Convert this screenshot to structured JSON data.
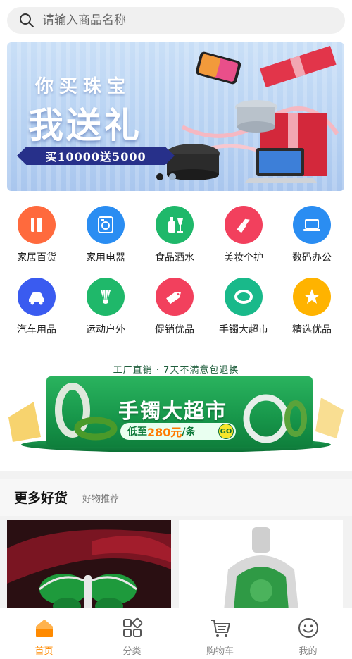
{
  "search": {
    "placeholder": "请输入商品名称"
  },
  "banner": {
    "line1": "你买珠宝",
    "line2": "我送礼",
    "promo": "买10000送5000",
    "slides": 2,
    "active_slide": 1
  },
  "categories": [
    {
      "label": "家居百货",
      "icon": "home-goods-icon",
      "color": "#ff6a3d"
    },
    {
      "label": "家用电器",
      "icon": "washing-machine-icon",
      "color": "#2a8df2"
    },
    {
      "label": "食品酒水",
      "icon": "wine-bottle-icon",
      "color": "#1fb86a"
    },
    {
      "label": "美妆个护",
      "icon": "lipstick-icon",
      "color": "#f2405d"
    },
    {
      "label": "数码办公",
      "icon": "laptop-icon",
      "color": "#2a8df2"
    },
    {
      "label": "汽车用品",
      "icon": "car-icon",
      "color": "#3a5bf0"
    },
    {
      "label": "运动户外",
      "icon": "badminton-icon",
      "color": "#1fb86a"
    },
    {
      "label": "促销优品",
      "icon": "sale-tag-icon",
      "color": "#f2405d"
    },
    {
      "label": "手镯大超市",
      "icon": "bracelet-icon",
      "color": "#19b98a"
    },
    {
      "label": "精选优品",
      "icon": "star-icon",
      "color": "#ffb300"
    }
  ],
  "jade_banner": {
    "tagline": "工厂直销 · 7天不满意包退换",
    "title": "手镯大超市",
    "price_prefix": "低至",
    "price_value": "280元",
    "price_suffix": "/条",
    "go": "GO"
  },
  "section": {
    "title": "更多好货",
    "subtitle": "好物推荐"
  },
  "nav": [
    {
      "label": "首页",
      "icon": "home-icon",
      "active": true
    },
    {
      "label": "分类",
      "icon": "category-icon",
      "active": false
    },
    {
      "label": "购物车",
      "icon": "cart-icon",
      "active": false
    },
    {
      "label": "我的",
      "icon": "profile-icon",
      "active": false
    }
  ],
  "colors": {
    "accent": "#ff8a00",
    "jade": "#17964a"
  }
}
